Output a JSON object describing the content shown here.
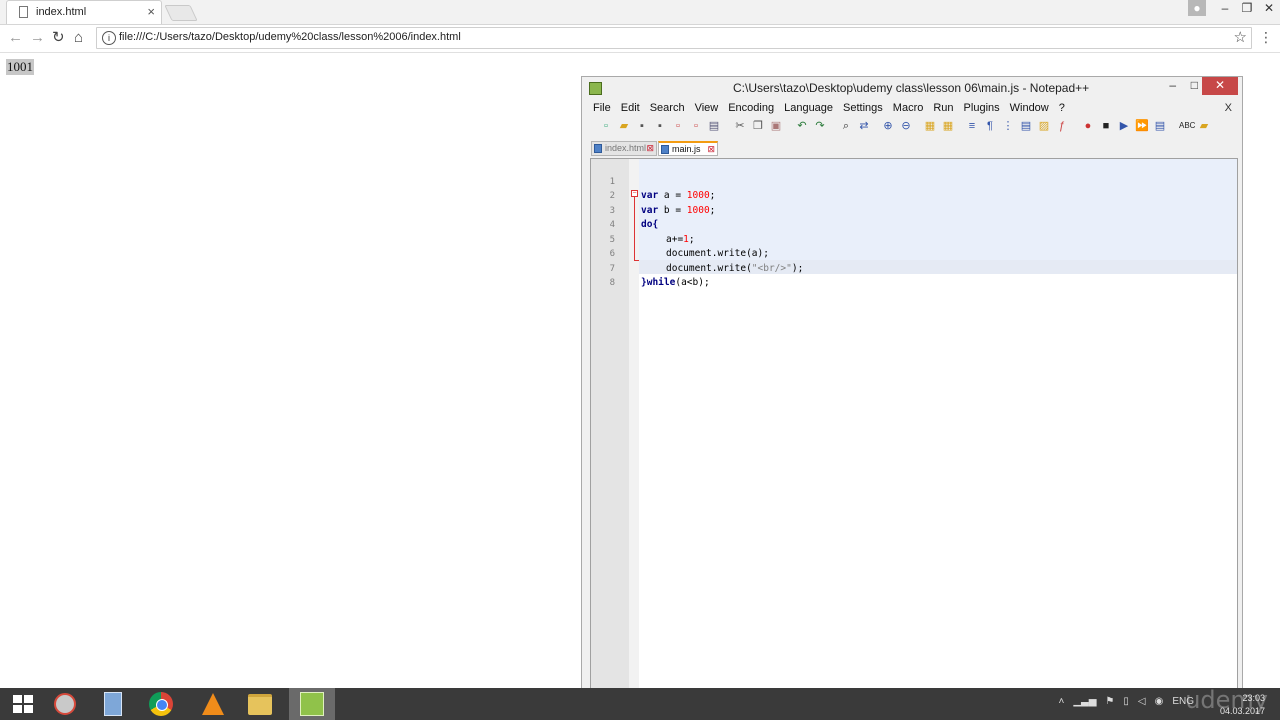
{
  "browser": {
    "tab_title": "index.html",
    "tab_close": "×",
    "url": "file:///C:/Users/tazo/Desktop/udemy%20class/lesson%2006/index.html",
    "back": "←",
    "forward": "→",
    "reload": "↻",
    "home": "⌂",
    "info": "i",
    "star": "☆",
    "menu": "⋮",
    "window_minimize": "–",
    "window_maximize": "❐",
    "window_close": "✕"
  },
  "page": {
    "output": "1001"
  },
  "notepad": {
    "caption": "C:\\Users\\tazo\\Desktop\\udemy class\\lesson 06\\main.js - Notepad++",
    "minimize": "–",
    "maximize": "□",
    "close": "✕",
    "menu": [
      "File",
      "Edit",
      "Search",
      "View",
      "Encoding",
      "Language",
      "Settings",
      "Macro",
      "Run",
      "Plugins",
      "Window",
      "?"
    ],
    "menu_close": "X",
    "tabs": [
      {
        "label": "index.html",
        "active": false
      },
      {
        "label": "main.js",
        "active": true
      }
    ],
    "lines": [
      {
        "n": "1",
        "code": "var a = 1000;"
      },
      {
        "n": "2",
        "code": "var b = 1000;"
      },
      {
        "n": "3",
        "code": "do{"
      },
      {
        "n": "4",
        "code": "    a+=1;"
      },
      {
        "n": "5",
        "code": "    document.write(a);"
      },
      {
        "n": "6",
        "code": "    document.write(\"<br/>\");"
      },
      {
        "n": "7",
        "code": "}while(a<b);"
      },
      {
        "n": "8",
        "code": ""
      }
    ],
    "tokens": {
      "var": "var",
      "a": " a = ",
      "b": " b = ",
      "num1000": "1000",
      "semi": ";",
      "do": "do",
      "brace_open": "{",
      "a_plus": "a+=",
      "one": "1",
      "write_a": "document.write(a);",
      "write_br_pre": "document.write(",
      "br_str": "\"<br/>\"",
      "write_br_post": ");",
      "brace_close": "}",
      "while": "while",
      "cond": "(a<b);"
    },
    "fold_marker": "−"
  },
  "taskbar": {
    "language": "ENG",
    "time": "23:03",
    "date": "04.03.2017",
    "watermark": "udemy"
  },
  "colors": {
    "keyword": "#000080",
    "number": "#ff0000",
    "string": "#808080",
    "active_tab_accent": "#f39c12",
    "close_button": "#c74848"
  }
}
